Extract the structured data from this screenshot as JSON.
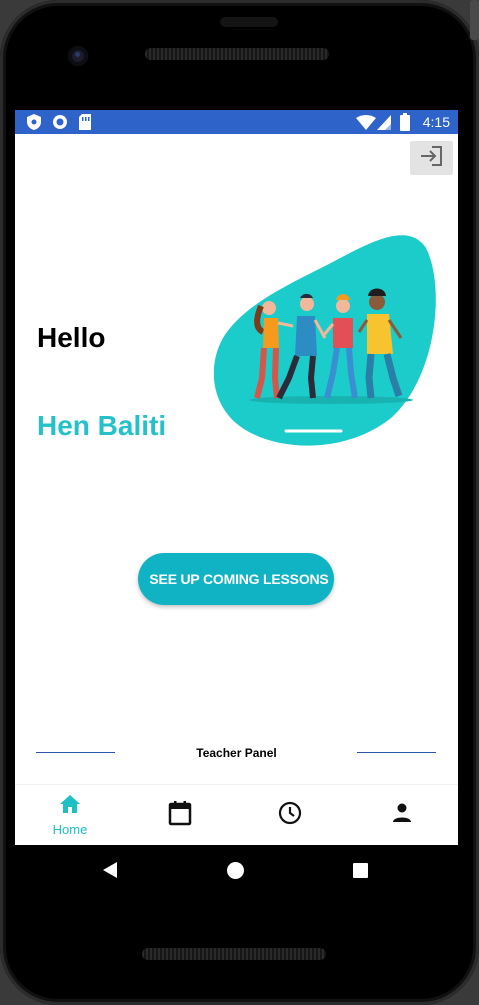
{
  "status_bar": {
    "time": "4:15",
    "left_icons": [
      "shield-icon",
      "circle-icon",
      "sim-card-icon"
    ],
    "right_icons": [
      "wifi-icon",
      "signal-icon",
      "battery-icon"
    ],
    "color": "#2e63c9"
  },
  "header": {
    "logout_icon": "logout-icon"
  },
  "main": {
    "greeting": "Hello",
    "user_name": "Hen Baliti",
    "upcoming_button": "SEE UP COMING LESSONS",
    "accent_color": "#24c2c8"
  },
  "footer": {
    "panel_label": "Teacher Panel"
  },
  "bottom_nav": {
    "items": [
      {
        "icon": "home-icon",
        "label": "Home",
        "active": true
      },
      {
        "icon": "calendar-icon",
        "label": ""
      },
      {
        "icon": "clock-icon",
        "label": ""
      },
      {
        "icon": "person-icon",
        "label": ""
      }
    ]
  },
  "system_nav": {
    "icons": [
      "back-icon",
      "home-circle-icon",
      "recents-icon"
    ]
  }
}
